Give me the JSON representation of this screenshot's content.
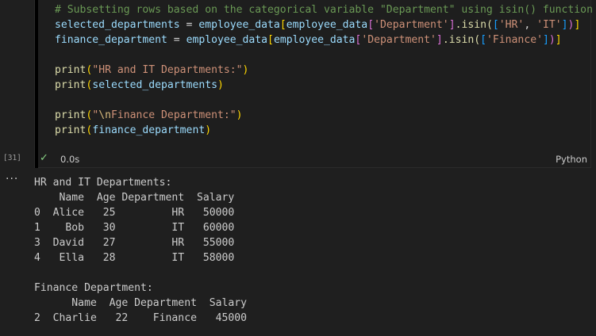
{
  "cell": {
    "execution_count": "[31]",
    "status_time": "0.0s",
    "language": "Python",
    "code": {
      "l1_comment": "# Subsetting rows based on the categorical variable \"Department\" using isin() function",
      "l2_var": "selected_departments",
      "l2_eq": " = ",
      "l2_obj": "employee_data",
      "l2_obj2": "employee_data",
      "l2_key": "'Department'",
      "l2_method": ".isin(",
      "l2_v1": "'HR'",
      "l2_sep": ", ",
      "l2_v2": "'IT'",
      "l3_var": "finance_department",
      "l3_eq": " = ",
      "l3_obj": "employee_data",
      "l3_obj2": "employee_data",
      "l3_key": "'Department'",
      "l3_method": ".isin(",
      "l3_v1": "'Finance'",
      "l5_fn": "print",
      "l5_str": "\"HR and IT Departments:\"",
      "l6_fn": "print",
      "l6_arg": "selected_departments",
      "l8_fn": "print",
      "l8_str_a": "\"",
      "l8_esc": "\\n",
      "l8_str_b": "Finance Department:\"",
      "l9_fn": "print",
      "l9_arg": "finance_department"
    }
  },
  "output": {
    "lines": [
      "HR and IT Departments:",
      "    Name  Age Department  Salary",
      "0  Alice   25         HR   50000",
      "1    Bob   30         IT   60000",
      "3  David   27         HR   55000",
      "4   Ella   28         IT   58000",
      "",
      "Finance Department:",
      "      Name  Age Department  Salary",
      "2  Charlie   22    Finance   45000"
    ]
  },
  "icons": {
    "check": "✓",
    "more": "···"
  }
}
